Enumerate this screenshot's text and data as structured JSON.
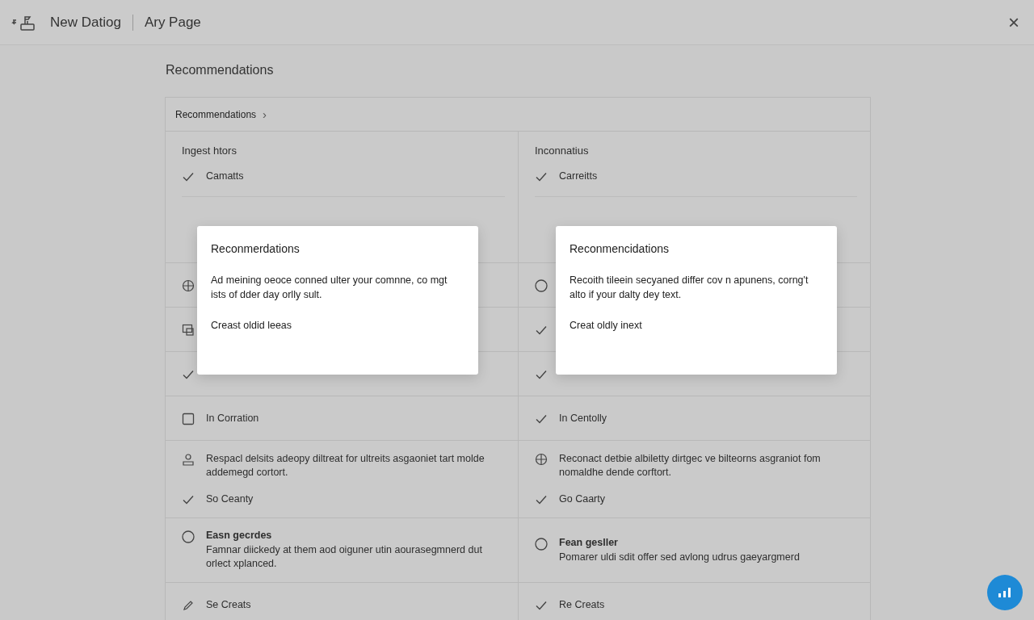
{
  "header": {
    "title": "New Datiog",
    "page": "Ary Page",
    "close": "×"
  },
  "heading": "Recommendations",
  "breadcrumb": {
    "label": "Recommendations",
    "chevron": "›"
  },
  "rows": [
    {
      "cells": [
        {
          "lines": [
            {
              "kind": "heading",
              "text": "Ingest htors"
            },
            {
              "kind": "check",
              "text": "Camatts"
            }
          ]
        },
        {
          "lines": [
            {
              "kind": "heading",
              "text": "Inconnatius"
            },
            {
              "kind": "check",
              "text": "Carreitts"
            }
          ]
        }
      ]
    },
    {
      "cells": [
        {
          "lines": [
            {
              "kind": "grid"
            }
          ]
        },
        {
          "lines": [
            {
              "kind": "circle"
            }
          ]
        }
      ]
    },
    {
      "cells": [
        {
          "lines": [
            {
              "kind": "doc"
            }
          ]
        },
        {
          "lines": [
            {
              "kind": "check"
            }
          ]
        }
      ]
    },
    {
      "cells": [
        {
          "lines": [
            {
              "kind": "check"
            }
          ]
        },
        {
          "lines": [
            {
              "kind": "check"
            }
          ]
        }
      ]
    },
    {
      "cells": [
        {
          "lines": [
            {
              "kind": "square",
              "text": "In Corration"
            }
          ]
        },
        {
          "lines": [
            {
              "kind": "check",
              "text": "In Centolly"
            }
          ]
        }
      ]
    },
    {
      "cells": [
        {
          "lines": [
            {
              "kind": "person",
              "text": "Respacl delsits adeopy diltreat for ultreits asgaoniet tart molde addemegd cortort."
            },
            {
              "kind": "check",
              "text": "So Ceanty"
            }
          ]
        },
        {
          "lines": [
            {
              "kind": "grid",
              "text": "Reconact detbie albiletty dirtgec ve bilteorns asgraniot fom nomaldhe dende corftort."
            },
            {
              "kind": "check",
              "text": "Go Caarty"
            }
          ]
        }
      ]
    },
    {
      "cells": [
        {
          "lines": [
            {
              "kind": "circle",
              "title": "Easn gecrdes",
              "text": "Famnar diickedy at them aod oiguner utin aourasegmnerd dut orlect xplanced."
            }
          ]
        },
        {
          "lines": [
            {
              "kind": "circle",
              "title": "Fean gesller",
              "text": "Pomarer uldi sdit offer sed avlong udrus gaeyargmerd"
            }
          ]
        }
      ]
    },
    {
      "cells": [
        {
          "lines": [
            {
              "kind": "pencil",
              "text": "Se Creats"
            }
          ]
        },
        {
          "lines": [
            {
              "kind": "check",
              "text": "Re Creats"
            }
          ]
        }
      ]
    }
  ],
  "popovers": [
    {
      "title": "Reconmerdations",
      "body": "Ad meining oeoce conned ulter your comnne, co mgt ists of dder day orlly sult.",
      "action": "Creast oldid leeas"
    },
    {
      "title": "Reconmencidations",
      "body": "Recoith tileein secyaned differ cov n apunens, corng't alto if your dalty dey text.",
      "action": "Creat oldly inext"
    }
  ]
}
